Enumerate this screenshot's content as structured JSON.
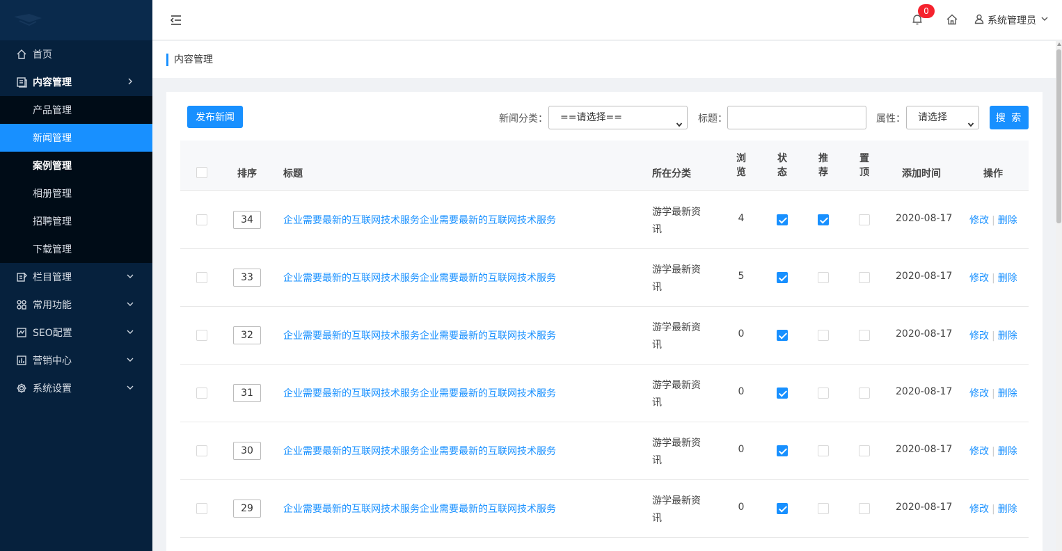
{
  "sidebar": {
    "menu": [
      {
        "label": "首页",
        "icon": "home-icon"
      },
      {
        "label": "内容管理",
        "icon": "document-icon"
      }
    ],
    "submenu": [
      {
        "label": "产品管理"
      },
      {
        "label": "新闻管理"
      },
      {
        "label": "案例管理"
      },
      {
        "label": "相册管理"
      },
      {
        "label": "招聘管理"
      },
      {
        "label": "下载管理"
      }
    ],
    "more": [
      {
        "label": "栏目管理",
        "icon": "columns-icon"
      },
      {
        "label": "常用功能",
        "icon": "apps-icon"
      },
      {
        "label": "SEO配置",
        "icon": "chart-icon"
      },
      {
        "label": "营销中心",
        "icon": "marketing-icon"
      },
      {
        "label": "系统设置",
        "icon": "gear-icon"
      }
    ]
  },
  "header": {
    "notification_count": "0",
    "user_name": "系统管理员"
  },
  "breadcrumb": "内容管理",
  "toolbar": {
    "publish_label": "发布新闻",
    "category_label": "新闻分类：",
    "category_value": "==请选择==",
    "title_label": "标题：",
    "title_value": "",
    "attr_label": "属性：",
    "attr_value": "请选择",
    "search_label": "搜 索"
  },
  "table": {
    "headers": {
      "sort": "排序",
      "title": "标题",
      "category": "所在分类",
      "views_1": "浏",
      "views_2": "览",
      "status_1": "状",
      "status_2": "态",
      "recommend_1": "推",
      "recommend_2": "荐",
      "top_1": "置",
      "top_2": "顶",
      "time": "添加时间",
      "ops": "操作"
    },
    "rows": [
      {
        "sort": "34",
        "title": "企业需要最新的互联网技术服务企业需要最新的互联网技术服务",
        "category": "游学最新资讯",
        "views": "4",
        "status": true,
        "recommend": true,
        "top": false,
        "date": "2020-08-17",
        "edit": "修改",
        "del": "删除"
      },
      {
        "sort": "33",
        "title": "企业需要最新的互联网技术服务企业需要最新的互联网技术服务",
        "category": "游学最新资讯",
        "views": "5",
        "status": true,
        "recommend": false,
        "top": false,
        "date": "2020-08-17",
        "edit": "修改",
        "del": "删除"
      },
      {
        "sort": "32",
        "title": "企业需要最新的互联网技术服务企业需要最新的互联网技术服务",
        "category": "游学最新资讯",
        "views": "0",
        "status": true,
        "recommend": false,
        "top": false,
        "date": "2020-08-17",
        "edit": "修改",
        "del": "删除"
      },
      {
        "sort": "31",
        "title": "企业需要最新的互联网技术服务企业需要最新的互联网技术服务",
        "category": "游学最新资讯",
        "views": "0",
        "status": true,
        "recommend": false,
        "top": false,
        "date": "2020-08-17",
        "edit": "修改",
        "del": "删除"
      },
      {
        "sort": "30",
        "title": "企业需要最新的互联网技术服务企业需要最新的互联网技术服务",
        "category": "游学最新资讯",
        "views": "0",
        "status": true,
        "recommend": false,
        "top": false,
        "date": "2020-08-17",
        "edit": "修改",
        "del": "删除"
      },
      {
        "sort": "29",
        "title": "企业需要最新的互联网技术服务企业需要最新的互联网技术服务",
        "category": "游学最新资讯",
        "views": "0",
        "status": true,
        "recommend": false,
        "top": false,
        "date": "2020-08-17",
        "edit": "修改",
        "del": "删除"
      }
    ]
  },
  "colors": {
    "sidebar_bg": "#06213d",
    "submenu_bg": "#000c17",
    "accent": "#1890ff",
    "badge": "#f5222d"
  }
}
